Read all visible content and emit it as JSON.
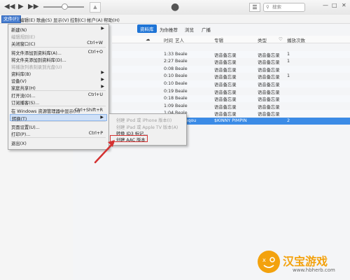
{
  "colors": {
    "accent": "#1e74d6",
    "selection": "#3b8be6",
    "annotation": "#d43232",
    "watermark": "#f3a20e"
  },
  "toolbar": {
    "prev_icon": "rewind-icon",
    "play_icon": "play-icon",
    "next_icon": "fast-forward-icon",
    "search_placeholder": "搜索"
  },
  "menubar": {
    "items": [
      "文件(F)",
      "编辑(E)",
      "歌曲(S)",
      "显示(V)",
      "控制(C)",
      "帐户(A)",
      "帮助(H)"
    ]
  },
  "tabs": [
    "资料库",
    "为你推荐",
    "浏览",
    "广播"
  ],
  "table": {
    "headers": [
      "时间",
      "艺人",
      "专辑",
      "类型",
      "播放次数"
    ],
    "rows": [
      {
        "time": "",
        "artist": "",
        "album": "",
        "genre": "",
        "plays": ""
      },
      {
        "time": "1:33",
        "artist": "Beale",
        "album": "语音备忘录",
        "genre": "语音备忘录",
        "plays": "1"
      },
      {
        "time": "2:27",
        "artist": "Beale",
        "album": "语音备忘录",
        "genre": "语音备忘录",
        "plays": "1"
      },
      {
        "time": "0:08",
        "artist": "Beale",
        "album": "语音备忘录",
        "genre": "语音备忘录",
        "plays": ""
      },
      {
        "time": "0:10",
        "artist": "Beale",
        "album": "语音备忘录",
        "genre": "语音备忘录",
        "plays": "1"
      },
      {
        "time": "0:10",
        "artist": "Beale",
        "album": "语音备忘录",
        "genre": "语音备忘录",
        "plays": ""
      },
      {
        "time": "0:19",
        "artist": "Beale",
        "album": "语音备忘录",
        "genre": "语音备忘录",
        "plays": ""
      },
      {
        "time": "0:18",
        "artist": "Beale",
        "album": "语音备忘录",
        "genre": "语音备忘录",
        "plays": ""
      },
      {
        "time": "1:09",
        "artist": "Beale",
        "album": "语音备忘录",
        "genre": "语音备忘录",
        "plays": ""
      },
      {
        "time": "1:04",
        "artist": "Beale",
        "album": "语音备忘录",
        "genre": "语音备忘录",
        "plays": ""
      },
      {
        "time": "0:11",
        "artist": "Beale",
        "album": "语音备忘录",
        "genre": "语音备忘录",
        "plays": "1"
      }
    ],
    "selected_row": {
      "artist": "JiH/dpqou",
      "album": "$KINNY PIMPIN",
      "plays": "2"
    }
  },
  "file_menu": {
    "items": [
      {
        "label": "新建(N)",
        "shortcut": "",
        "submenu": true,
        "disabled": false
      },
      {
        "label": "编辑规则(E)",
        "shortcut": "",
        "submenu": false,
        "disabled": true
      },
      {
        "label": "关闭窗口(C)",
        "shortcut": "Ctrl+W",
        "submenu": false,
        "disabled": false
      },
      {
        "label": "将文件添加到资料库(A)...",
        "shortcut": "Ctrl+O",
        "submenu": false,
        "disabled": false
      },
      {
        "label": "将文件夹添加到资料库(D)...",
        "shortcut": "",
        "submenu": false,
        "disabled": false
      },
      {
        "label": "将播放列表刻录到光盘(U)",
        "shortcut": "",
        "submenu": false,
        "disabled": true
      },
      {
        "label": "资料库(B)",
        "shortcut": "",
        "submenu": true,
        "disabled": false
      },
      {
        "label": "设备(V)",
        "shortcut": "",
        "submenu": true,
        "disabled": false
      },
      {
        "label": "家庭共享(H)",
        "shortcut": "",
        "submenu": true,
        "disabled": false
      },
      {
        "label": "打开流(O)...",
        "shortcut": "Ctrl+U",
        "submenu": false,
        "disabled": false
      },
      {
        "label": "订阅播客(S)...",
        "shortcut": "",
        "submenu": false,
        "disabled": false
      },
      {
        "label": "在 Windows 资源管理器中显示(H)",
        "shortcut": "Ctrl+Shift+R",
        "submenu": false,
        "disabled": false
      },
      {
        "label": "转换(T)",
        "shortcut": "",
        "submenu": true,
        "disabled": false
      },
      {
        "label": "页面设置(U)...",
        "shortcut": "",
        "submenu": false,
        "disabled": false
      },
      {
        "label": "打印(P)...",
        "shortcut": "Ctrl+P",
        "submenu": false,
        "disabled": false
      },
      {
        "label": "退出(X)",
        "shortcut": "",
        "submenu": false,
        "disabled": false
      }
    ]
  },
  "convert_menu": {
    "items": [
      {
        "label": "创建 iPod 或 iPhone 版本(I)",
        "disabled": true
      },
      {
        "label": "创建 iPad 或 Apple TV 版本(A)",
        "disabled": true
      },
      {
        "label": "转换 ID3 标记...",
        "disabled": false
      },
      {
        "label": "创建 AAC 版本",
        "disabled": false
      }
    ]
  },
  "watermark": {
    "title": "汉宝游戏",
    "url": "www.hbherb.com"
  }
}
